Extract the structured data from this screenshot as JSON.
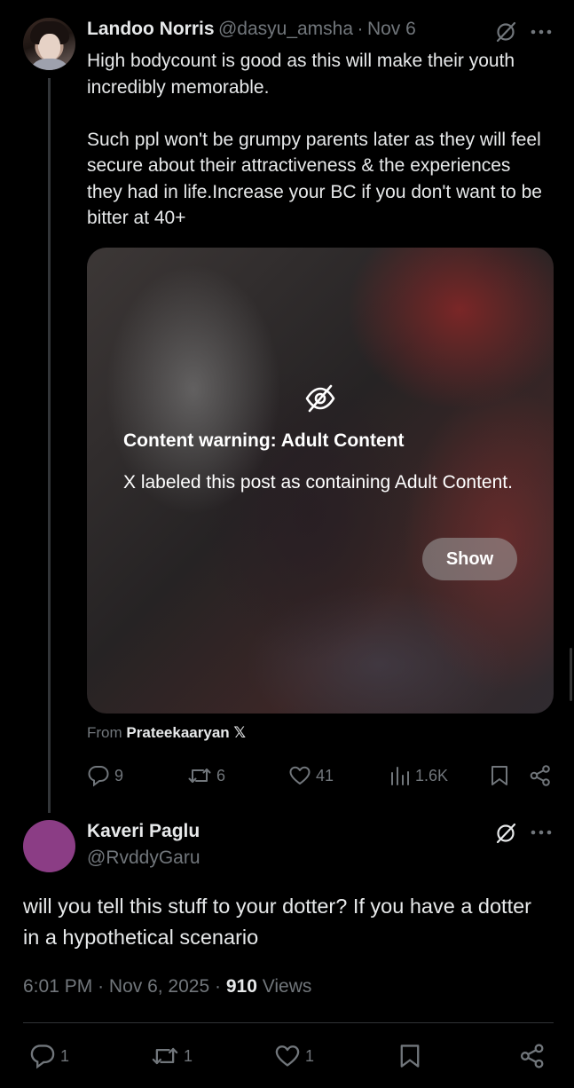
{
  "tweet": {
    "author_name": "Landoo Norris",
    "handle": "@dasyu_amsha",
    "separator": "·",
    "date": "Nov 6",
    "paragraphs": [
      "High bodycount is good as this will make their youth incredibly memorable.",
      "Such ppl won't be grumpy parents later as they will feel secure about their attractiveness & the experiences they had in life.Increase your BC if you don't want to be bitter at 40+"
    ],
    "media_warning": {
      "icon": "eye-slash-icon",
      "title": "Content warning: Adult Content",
      "body": "X labeled this post as containing Adult Content.",
      "show_label": "Show"
    },
    "from_prefix": "From",
    "from_name": "Prateekaaryan",
    "from_logo": "𝕏",
    "actions": {
      "replies": "9",
      "reposts": "6",
      "likes": "41",
      "views": "1.6K"
    }
  },
  "reply": {
    "author_name": "Kaveri Paglu",
    "handle": "@RvddyGaru",
    "text": "will you tell this stuff to your dotter? If you have a dotter in a hypothetical scenario",
    "time": "6:01 PM",
    "separator": "·",
    "date": "Nov 6, 2025",
    "separator2": "·",
    "views_count": "910",
    "views_label": "Views",
    "actions": {
      "replies": "1",
      "reposts": "1",
      "likes": "1"
    },
    "avatar_color": "#8b3d85"
  },
  "colors": {
    "background": "#000000",
    "text": "#e7e9ea",
    "muted": "#71767b"
  }
}
